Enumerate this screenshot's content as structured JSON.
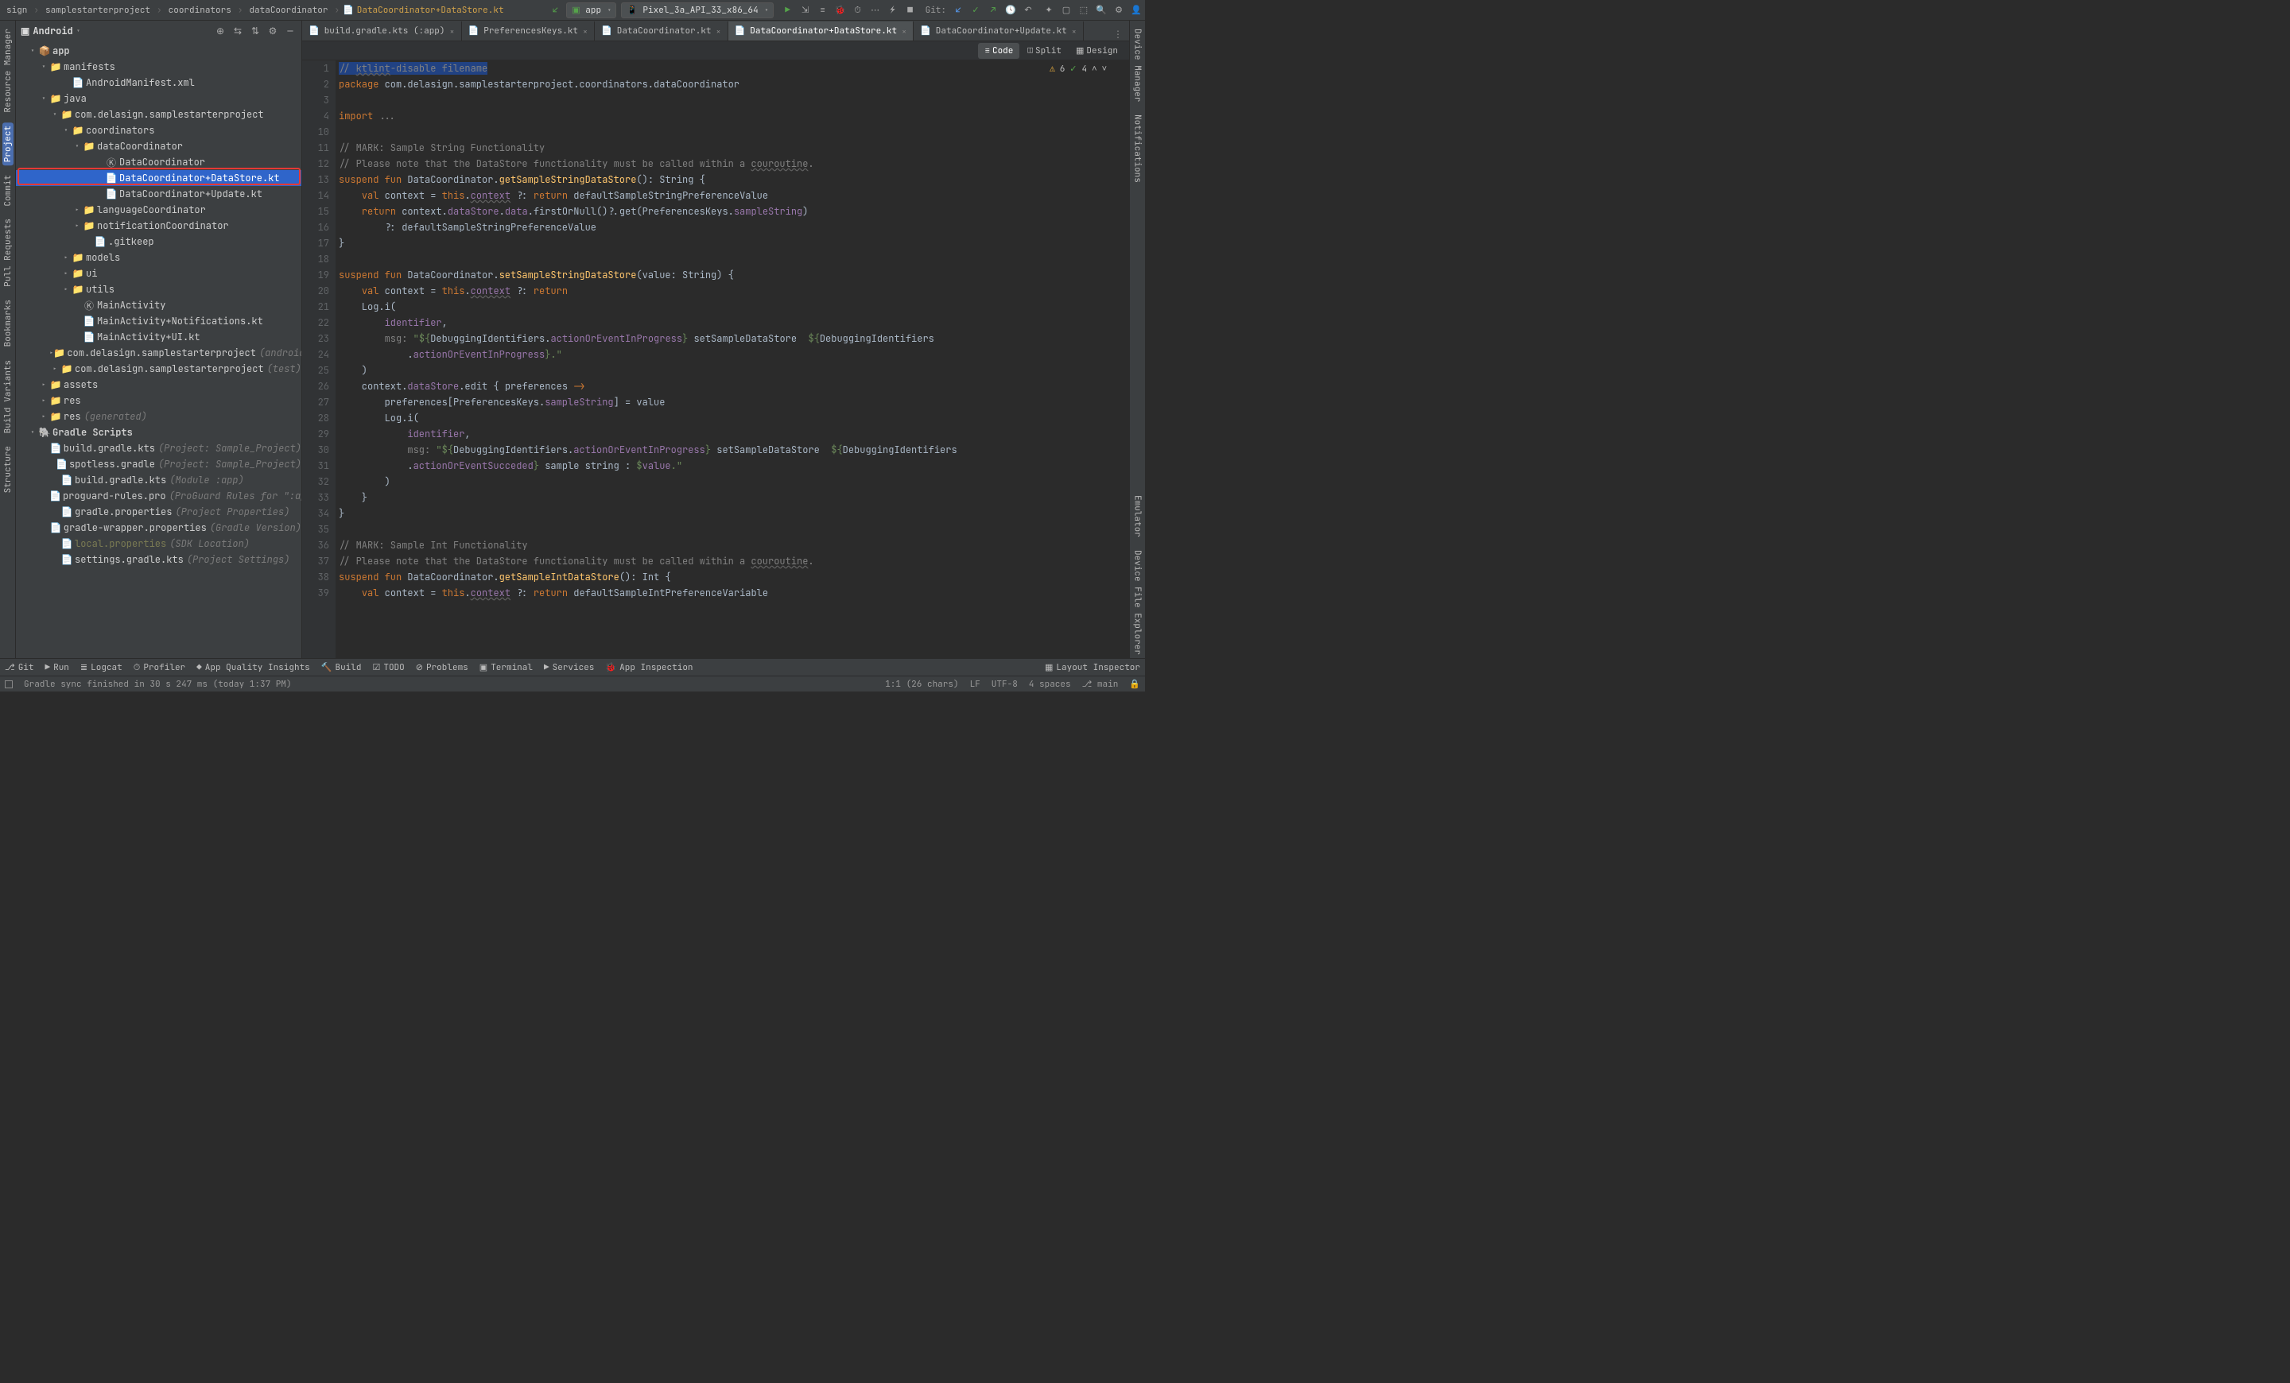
{
  "breadcrumb": [
    "sign",
    "samplestarterproject",
    "coordinators",
    "dataCoordinator",
    "DataCoordinator+DataStore.kt"
  ],
  "run_config": "app",
  "device": "Pixel_3a_API_33_x86_64",
  "git_label": "Git:",
  "side_title": "Android",
  "tree": {
    "app": "app",
    "manifests": "manifests",
    "android_manifest": "AndroidManifest.xml",
    "java": "java",
    "pkg": "com.delasign.samplestarterproject",
    "coordinators": "coordinators",
    "dataCoordinator": "dataCoordinator",
    "DataCoordinator": "DataCoordinator",
    "DataCoordinator_DataStore": "DataCoordinator+DataStore.kt",
    "DataCoordinator_Update": "DataCoordinator+Update.kt",
    "languageCoordinator": "languageCoordinator",
    "notificationCoordinator": "notificationCoordinator",
    "gitkeep": ".gitkeep",
    "models": "models",
    "ui": "ui",
    "utils": "utils",
    "MainActivity": "MainActivity",
    "MainActivity_Notifications": "MainActivity+Notifications.kt",
    "MainActivity_UI": "MainActivity+UI.kt",
    "pkg_androidTest": "com.delasign.samplestarterproject",
    "pkg_androidTest_suffix": "(androidTest)",
    "pkg_test": "com.delasign.samplestarterproject",
    "pkg_test_suffix": "(test)",
    "assets": "assets",
    "res": "res",
    "res_gen": "res",
    "res_gen_suffix": "(generated)",
    "gradle_scripts": "Gradle Scripts",
    "build_gradle_proj": "build.gradle.kts",
    "build_gradle_proj_suffix": "(Project: Sample_Project)",
    "spotless": "spotless.gradle",
    "spotless_suffix": "(Project: Sample_Project)",
    "build_gradle_mod": "build.gradle.kts",
    "build_gradle_mod_suffix": "(Module :app)",
    "proguard": "proguard-rules.pro",
    "proguard_suffix": "(ProGuard Rules for \":app\")",
    "gradle_props": "gradle.properties",
    "gradle_props_suffix": "(Project Properties)",
    "gradle_wrapper": "gradle-wrapper.properties",
    "gradle_wrapper_suffix": "(Gradle Version)",
    "local_props": "local.properties",
    "local_props_suffix": "(SDK Location)",
    "settings_gradle": "settings.gradle.kts",
    "settings_gradle_suffix": "(Project Settings)"
  },
  "tabs": [
    {
      "label": "build.gradle.kts (:app)"
    },
    {
      "label": "PreferencesKeys.kt"
    },
    {
      "label": "DataCoordinator.kt"
    },
    {
      "label": "DataCoordinator+DataStore.kt",
      "active": true
    },
    {
      "label": "DataCoordinator+Update.kt"
    }
  ],
  "viewmodes": {
    "code": "Code",
    "split": "Split",
    "design": "Design"
  },
  "inspection": {
    "warn": "6",
    "ok": "4"
  },
  "gutter_start": 1,
  "code_lines": [
    "1|<span class='cm'><span class='hlsel'>// </span><span class='hlsel uline'>ktlint</span><span class='hlsel'>-disable filename</span></span>",
    "2|<span class='kw'>package</span> com.delasign.samplestarterproject.coordinators.dataCoordinator",
    "3|",
    "4|<span class='kw'>import</span> <span class='cm'>...</span>",
    "10|",
    "11|<span class='cm'>// MARK: Sample String Functionality</span>",
    "12|<span class='cm'>// Please note that the DataStore functionality must be called within a <span class='uline'>couroutine</span>.</span>",
    "13|<span class='kw'>suspend fun</span> DataCoordinator.<span class='fn'>getSampleStringDataStore</span>(): String {",
    "14|    <span class='kw'>val</span> context = <span class='kw'>this</span>.<span class='id uline'>context</span> ?: <span class='kw'>return</span> defaultSampleStringPreferenceValue",
    "15|    <span class='kw'>return</span> context.<span class='id'>dataStore</span>.<span class='id'>data</span>.firstOrNull()?.get(PreferencesKeys.<span class='id'>sampleString</span>)",
    "16|        ?: defaultSampleStringPreferenceValue",
    "17|}",
    "18|",
    "19|<span class='kw'>suspend fun</span> DataCoordinator.<span class='fn'>setSampleStringDataStore</span>(value: String) {",
    "20|    <span class='kw'>val</span> context = <span class='kw'>this</span>.<span class='id uline'>context</span> ?: <span class='kw'>return</span>",
    "21|    Log.i(",
    "22|        <span class='id'>identifier</span>,",
    "23|        <span class='cm'>msg:</span> <span class='str'>\"${</span>DebuggingIdentifiers.<span class='id'>actionOrEventInProgress</span><span class='str'>}</span> setSampleDataStore  <span class='str'>${</span>DebuggingIdentifiers",
    "24|            .<span class='id'>actionOrEventInProgress</span><span class='str'>}.\"</span>",
    "25|    )",
    "26|    context.<span class='id'>dataStore</span>.edit { preferences <span class='kw'>-&gt;</span>",
    "27|        preferences[PreferencesKeys.<span class='id'>sampleString</span>] = value",
    "28|        Log.i(",
    "29|            <span class='id'>identifier</span>,",
    "30|            <span class='cm'>msg:</span> <span class='str'>\"${</span>DebuggingIdentifiers.<span class='id'>actionOrEventInProgress</span><span class='str'>}</span> setSampleDataStore  <span class='str'>${</span>DebuggingIdentifiers",
    "31|            .<span class='id'>actionOrEventSucceded</span><span class='str'>}</span> sample string : <span class='str'>$</span><span class='id'>value</span><span class='str'>.\"</span>",
    "32|        )",
    "33|    }",
    "34|}",
    "35|",
    "36|<span class='cm'>// MARK: Sample Int Functionality</span>",
    "37|<span class='cm'>// Please note that the DataStore functionality must be called within a <span class='uline'>couroutine</span>.</span>",
    "38|<span class='kw'>suspend fun</span> DataCoordinator.<span class='fn'>getSampleIntDataStore</span>(): Int {",
    "39|    <span class='kw'>val</span> context = <span class='kw'>this</span>.<span class='id uline'>context</span> ?: <span class='kw'>return</span> defaultSampleIntPreferenceVariable"
  ],
  "line_numbers": [
    "1",
    "2",
    "3",
    "4",
    "10",
    "11",
    "12",
    "13",
    "14",
    "15",
    "16",
    "17",
    "18",
    "19",
    "20",
    "21",
    "22",
    "23",
    "24",
    "25",
    "26",
    "27",
    "28",
    "29",
    "30",
    "31",
    "32",
    "33",
    "34",
    "35",
    "36",
    "37",
    "38",
    "39"
  ],
  "left_gutter": [
    "Resource Manager",
    "Project",
    "Commit",
    "Pull Requests",
    "Bookmarks",
    "Build Variants",
    "Structure"
  ],
  "right_gutter_top": [
    "Device Manager",
    "Notifications"
  ],
  "right_gutter_bottom": [
    "Emulator",
    "Device File Explorer"
  ],
  "tools": [
    "Git",
    "Run",
    "Logcat",
    "Profiler",
    "App Quality Insights",
    "Build",
    "TODO",
    "Problems",
    "Terminal",
    "Services",
    "App Inspection"
  ],
  "tools_right": "Layout Inspector",
  "status_msg": "Gradle sync finished in 30 s 247 ms (today 1:37 PM)",
  "status_right": {
    "pos": "1:1 (26 chars)",
    "le": "LF",
    "enc": "UTF-8",
    "indent": "4 spaces",
    "branch": "main"
  }
}
